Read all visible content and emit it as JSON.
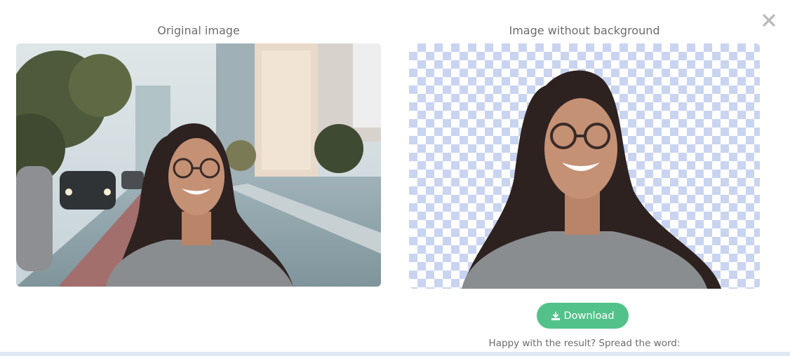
{
  "modal": {
    "original_title": "Original image",
    "result_title": "Image without background",
    "download_label": "Download",
    "share_text": "Happy with the result? Spread the word:",
    "close_icon": "close-icon",
    "download_icon": "download-icon"
  },
  "colors": {
    "accent": "#53c28a",
    "checker": "#c9d4f0",
    "text": "#6c6c6c",
    "close": "#b8b8b8"
  }
}
